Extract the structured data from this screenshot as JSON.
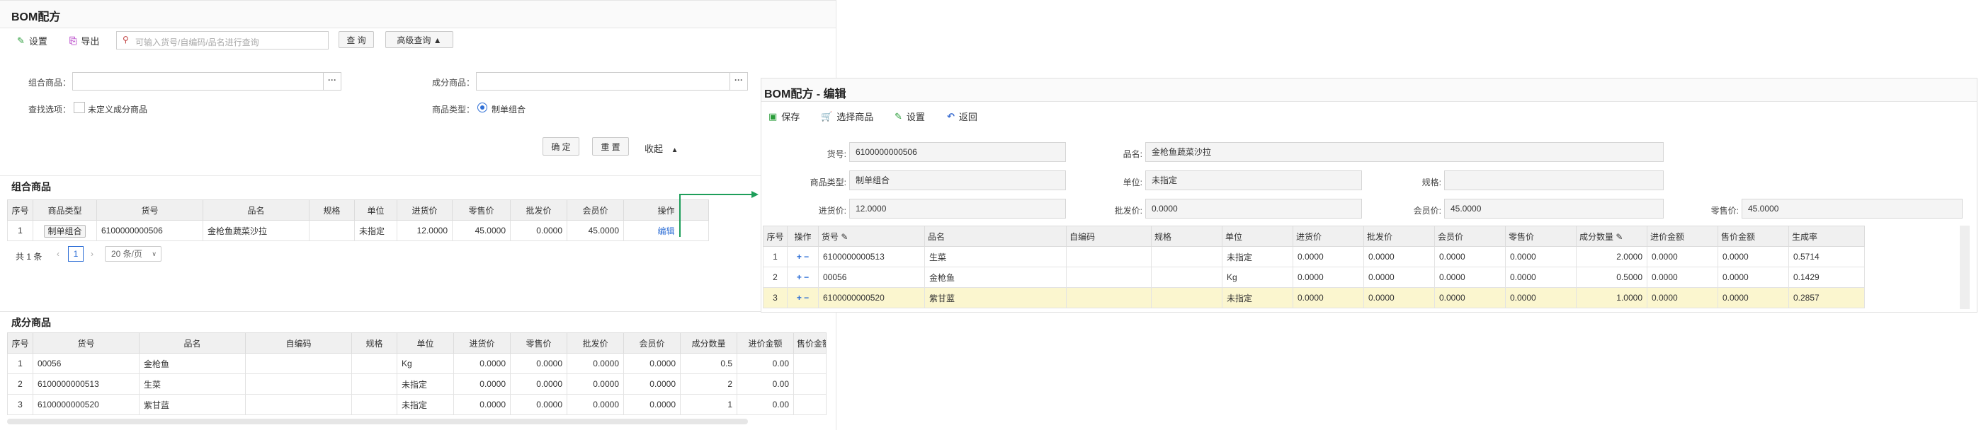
{
  "left": {
    "title": "BOM配方",
    "toolbar": {
      "settings": "设置",
      "export": "导出",
      "search_placeholder": "可输入货号/自编码/品名进行查询",
      "query": "查 询",
      "advanced": "高级查询"
    },
    "filter": {
      "combo_label": "组合商品：",
      "component_label": "成分商品：",
      "search_option_label": "查找选项：",
      "undefined_component": "未定义成分商品",
      "product_type_label": "商品类型：",
      "product_type_value": "制单组合",
      "confirm": "确 定",
      "reset": "重 置",
      "collapse": "收起"
    },
    "combo": {
      "section_title": "组合商品",
      "headers": [
        "序号",
        "商品类型",
        "货号",
        "品名",
        "规格",
        "单位",
        "进货价",
        "零售价",
        "批发价",
        "会员价",
        "操作"
      ],
      "rows": [
        [
          "1",
          "制单组合",
          "6100000000506",
          "金枪鱼蔬菜沙拉",
          "",
          "未指定",
          "12.0000",
          "45.0000",
          "0.0000",
          "45.0000",
          "编辑"
        ]
      ],
      "pager": {
        "total": "共 1 条",
        "page": "1",
        "per_page": "20 条/页"
      }
    },
    "component": {
      "section_title": "成分商品",
      "headers": [
        "序号",
        "货号",
        "品名",
        "自编码",
        "规格",
        "单位",
        "进货价",
        "零售价",
        "批发价",
        "会员价",
        "成分数量",
        "进价金额",
        "售价金额"
      ],
      "rows": [
        [
          "1",
          "00056",
          "金枪鱼",
          "",
          "",
          "Kg",
          "0.0000",
          "0.0000",
          "0.0000",
          "0.0000",
          "0.5",
          "0.00",
          ""
        ],
        [
          "2",
          "6100000000513",
          "生菜",
          "",
          "",
          "未指定",
          "0.0000",
          "0.0000",
          "0.0000",
          "0.0000",
          "2",
          "0.00",
          ""
        ],
        [
          "3",
          "6100000000520",
          "紫甘蓝",
          "",
          "",
          "未指定",
          "0.0000",
          "0.0000",
          "0.0000",
          "0.0000",
          "1",
          "0.00",
          ""
        ]
      ]
    }
  },
  "right": {
    "title": "BOM配方 - 编辑",
    "toolbar": {
      "save": "保存",
      "select_product": "选择商品",
      "settings": "设置",
      "back": "返回"
    },
    "form": {
      "sku_label": "货号:",
      "sku": "6100000000506",
      "name_label": "品名:",
      "name": "金枪鱼蔬菜沙拉",
      "type_label": "商品类型:",
      "type": "制单组合",
      "unit_label": "单位:",
      "unit": "未指定",
      "spec_label": "规格:",
      "spec": "",
      "cost_label": "进货价:",
      "cost": "12.0000",
      "wholesale_label": "批发价:",
      "wholesale": "0.0000",
      "member_label": "会员价:",
      "member": "45.0000",
      "retail_label": "零售价:",
      "retail": "45.0000"
    },
    "table": {
      "headers": [
        "序号",
        "操作",
        "货号",
        "品名",
        "自编码",
        "规格",
        "单位",
        "进货价",
        "批发价",
        "会员价",
        "零售价",
        "成分数量",
        "进价金额",
        "售价金额",
        "生成率"
      ],
      "rows": [
        [
          "1",
          "+ −",
          "6100000000513",
          "生菜",
          "",
          "",
          "未指定",
          "0.0000",
          "0.0000",
          "0.0000",
          "0.0000",
          "2.0000",
          "0.0000",
          "0.0000",
          "0.5714"
        ],
        [
          "2",
          "+ −",
          "00056",
          "金枪鱼",
          "",
          "",
          "Kg",
          "0.0000",
          "0.0000",
          "0.0000",
          "0.0000",
          "0.5000",
          "0.0000",
          "0.0000",
          "0.1429"
        ],
        [
          "3",
          "+ −",
          "6100000000520",
          "紫甘蓝",
          "",
          "",
          "未指定",
          "0.0000",
          "0.0000",
          "0.0000",
          "0.0000",
          "1.0000",
          "0.0000",
          "0.0000",
          "0.2857"
        ]
      ]
    }
  },
  "colors": {
    "accent_blue": "#2f6fd6",
    "green_arrow": "#1e9e5a",
    "highlight_row": "#fbf6cf"
  }
}
